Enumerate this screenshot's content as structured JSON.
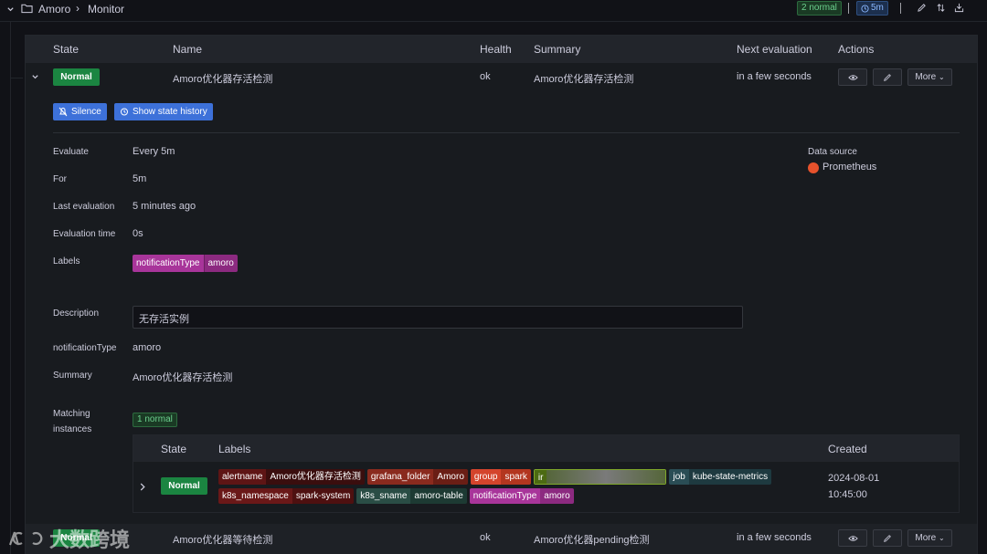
{
  "breadcrumb": {
    "parent": "Amoro",
    "current": "Monitor"
  },
  "toolbar": {
    "normal_count": "2 normal",
    "interval": "5m"
  },
  "table": {
    "headers": [
      "State",
      "Name",
      "Health",
      "Summary",
      "Next evaluation",
      "Actions"
    ]
  },
  "rules": [
    {
      "state": "Normal",
      "name": "Amoro优化器存活检测",
      "health": "ok",
      "summary": "Amoro优化器存活检测",
      "next": "in a few seconds",
      "more": "More"
    },
    {
      "state": "Normal",
      "name": "Amoro优化器等待检测",
      "health": "ok",
      "summary": "Amoro优化器pending检测",
      "next": "in a few seconds",
      "more": "More"
    }
  ],
  "buttons": {
    "silence": "Silence",
    "history": "Show state history"
  },
  "details": {
    "evaluate_label": "Evaluate",
    "evaluate_value": "Every 5m",
    "for_label": "For",
    "for_value": "5m",
    "last_label": "Last evaluation",
    "last_value": "5 minutes ago",
    "evaltime_label": "Evaluation time",
    "evaltime_value": "0s",
    "labels_label": "Labels",
    "label_key": "notificationType",
    "label_val": "amoro",
    "desc_label": "Description",
    "desc_value": "无存活实例",
    "ntype_label": "notificationType",
    "ntype_value": "amoro",
    "summary_label": "Summary",
    "summary_value": "Amoro优化器存活检测",
    "matching_label_1": "Matching",
    "matching_label_2": "instances",
    "matching_badge": "1 normal"
  },
  "datasource": {
    "label": "Data source",
    "name": "Prometheus",
    "color": "#e6522c"
  },
  "instances": {
    "headers": {
      "state": "State",
      "labels": "Labels",
      "created": "Created"
    },
    "row": {
      "state": "Normal",
      "created_date": "2024-08-01",
      "created_time": "10:45:00",
      "labels": [
        {
          "k": "alertname",
          "v": "Amoro优化器存活检测",
          "kbg": "#5e1515",
          "vbg": "#3a0e0e"
        },
        {
          "k": "grafana_folder",
          "v": "Amoro",
          "kbg": "#8a2a1e",
          "vbg": "#6a1e15"
        },
        {
          "k": "group",
          "v": "spark",
          "kbg": "#d4442c",
          "vbg": "#b3361f"
        },
        {
          "k": "ir",
          "v": "",
          "kbg": "#4c6a12",
          "vbg": "#4a5e32"
        },
        {
          "k": "job",
          "v": "kube-state-metrics",
          "kbg": "#2a4d55",
          "vbg": "#1e3a40"
        },
        {
          "k": "k8s_namespace",
          "v": "spark-system",
          "kbg": "#6a1818",
          "vbg": "#4e1010"
        },
        {
          "k": "k8s_sname",
          "v": "amoro-table",
          "kbg": "#2a4d45",
          "vbg": "#1d3a33"
        },
        {
          "k": "notificationType",
          "v": "amoro",
          "kbg": "#a8359a",
          "vbg": "#8c2a80"
        }
      ]
    }
  },
  "watermark": "大数跨境"
}
